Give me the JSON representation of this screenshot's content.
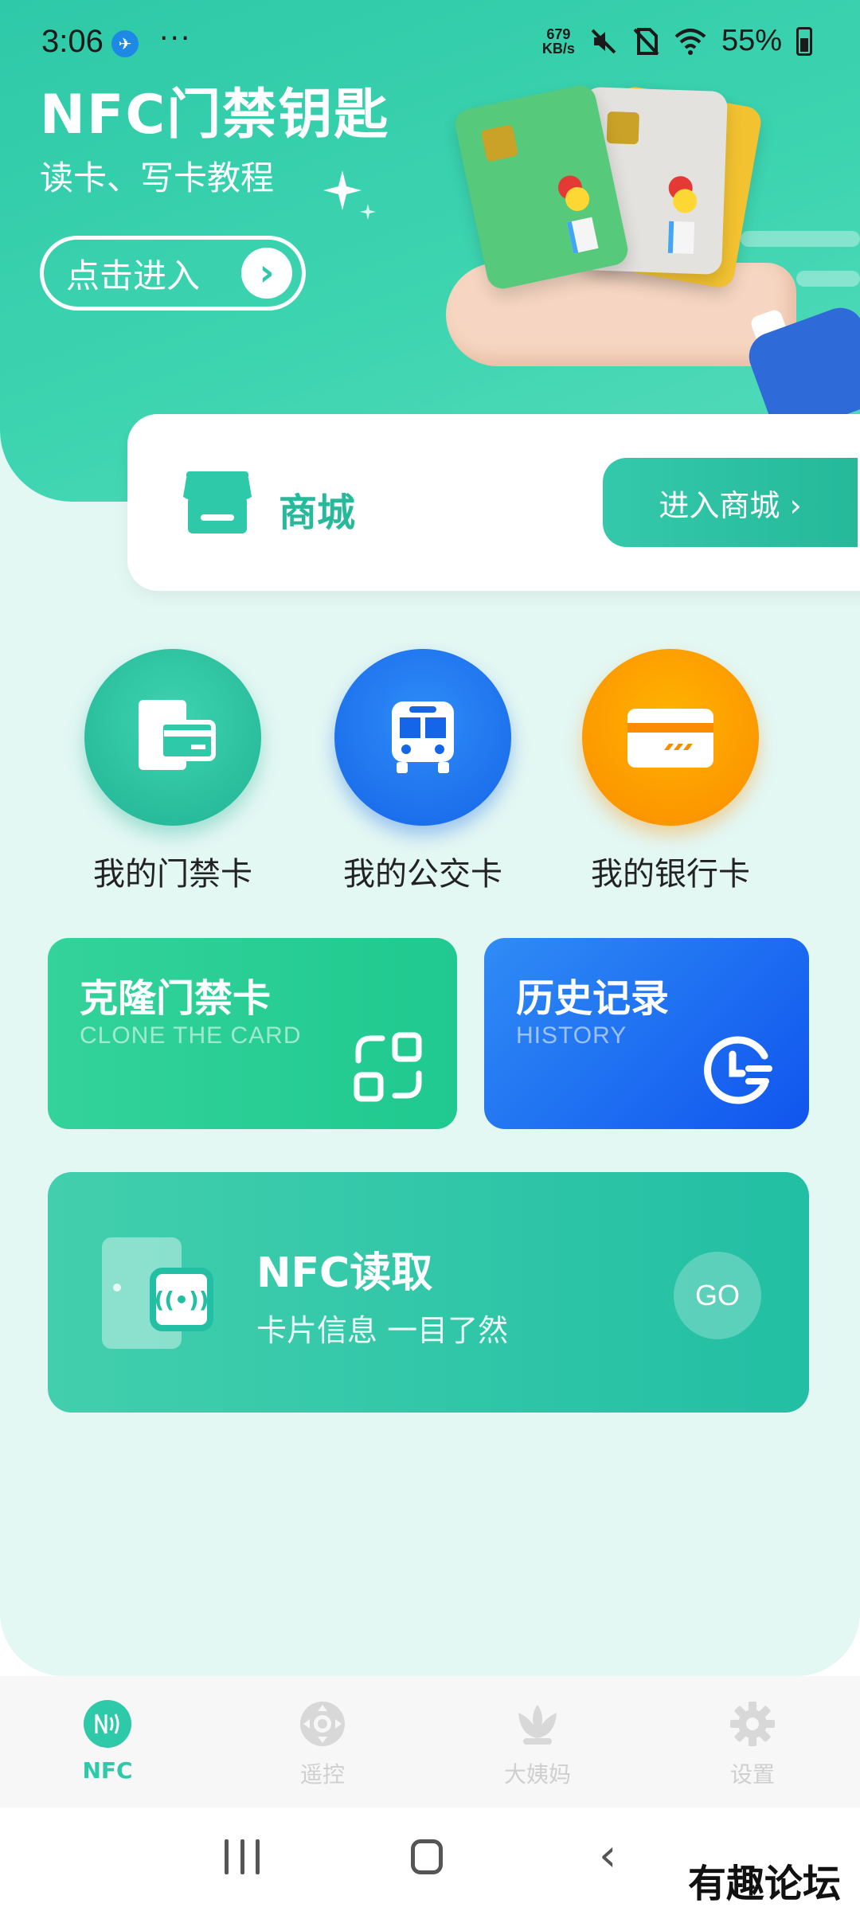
{
  "status_bar": {
    "time": "3:06",
    "dots": "···",
    "net_speed_value": "679",
    "net_speed_unit": "KB/s",
    "battery": "55%"
  },
  "hero": {
    "title": "NFC门禁钥匙",
    "subtitle": "读卡、写卡教程",
    "enter_button": "点击进入",
    "enter_arrow": "›"
  },
  "store": {
    "label": "商城",
    "button": "进入商城 ›"
  },
  "quick_actions": [
    {
      "label": "我的门禁卡",
      "icon": "access-card-icon",
      "color": "#22b394"
    },
    {
      "label": "我的公交卡",
      "icon": "bus-icon",
      "color": "#1565e8"
    },
    {
      "label": "我的银行卡",
      "icon": "bank-card-icon",
      "color": "#fb8c00"
    }
  ],
  "tiles": {
    "clone": {
      "title": "克隆门禁卡",
      "subtitle": "CLONE THE CARD"
    },
    "history": {
      "title": "历史记录",
      "subtitle": "HISTORY"
    }
  },
  "nfc_read": {
    "title": "NFC读取",
    "desc": "卡片信息 一目了然",
    "go": "GO"
  },
  "tabbar": [
    {
      "label": "NFC",
      "icon": "nfc-icon",
      "active": true
    },
    {
      "label": "遥控",
      "icon": "remote-icon",
      "active": false
    },
    {
      "label": "大姨妈",
      "icon": "lotus-icon",
      "active": false
    },
    {
      "label": "设置",
      "icon": "gear-icon",
      "active": false
    }
  ],
  "watermark": "有趣论坛",
  "colors": {
    "accent": "#2ec9a8",
    "background": "#e3f7f3",
    "blue": "#1565e8",
    "orange": "#fb8c00"
  }
}
